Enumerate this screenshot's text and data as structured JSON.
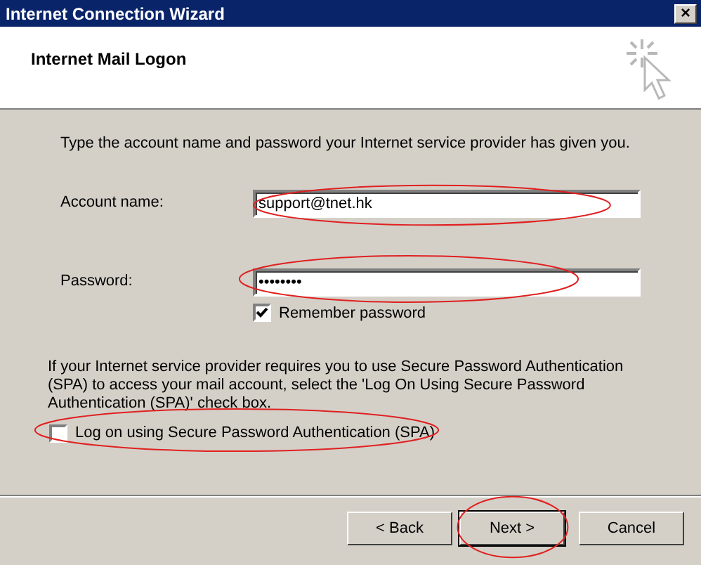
{
  "window": {
    "title": "Internet Connection Wizard",
    "close": "×"
  },
  "header": {
    "title": "Internet Mail Logon"
  },
  "intro": "Type the account name and password your Internet service provider has given you.",
  "fields": [
    {
      "label": "Account name:",
      "value": "support@tnet.hk",
      "circled": true
    },
    {
      "label": "Password:",
      "value": "••••••••",
      "circled": true
    }
  ],
  "remember": {
    "label": "Remember password",
    "checked": true
  },
  "spa_note": "If your Internet service provider requires you to use Secure Password Authentication (SPA) to access your mail account, select the 'Log On Using Secure Password Authentication (SPA)' check box.",
  "spa": {
    "label": "Log on using Secure Password Authentication (SPA)",
    "checked": false,
    "circled": true
  },
  "buttons": [
    {
      "label": "< Back",
      "default": false,
      "circled": false
    },
    {
      "label": "Next >",
      "default": true,
      "circled": true
    },
    {
      "label": "Cancel",
      "default": false,
      "circled": false
    }
  ]
}
